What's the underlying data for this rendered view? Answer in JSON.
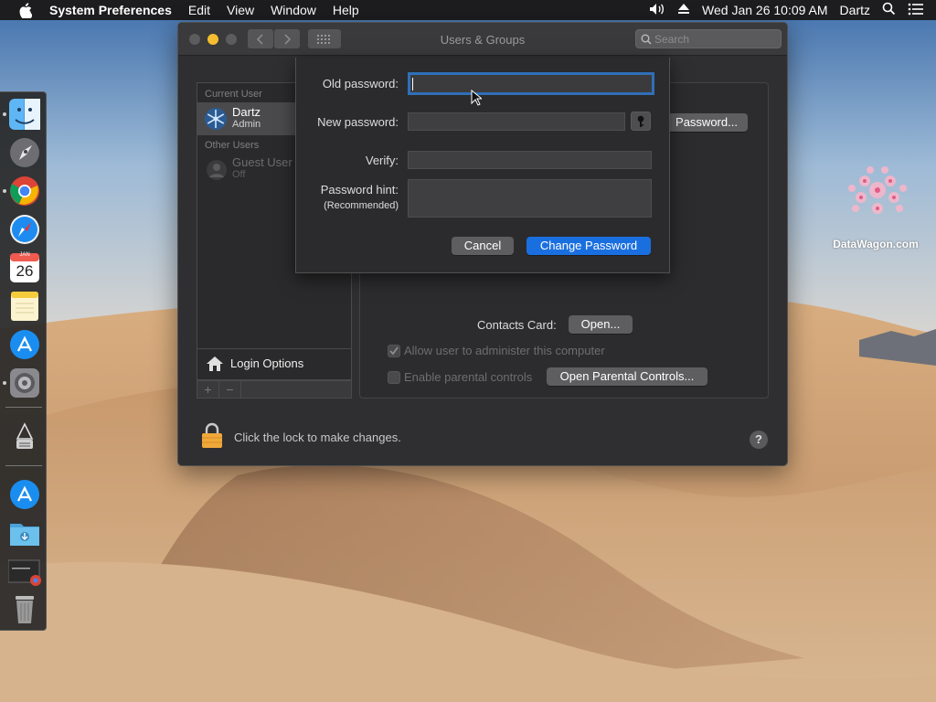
{
  "menubar": {
    "app_name": "System Preferences",
    "items": [
      "Edit",
      "View",
      "Window",
      "Help"
    ],
    "datetime": "Wed Jan 26  10:09 AM",
    "user": "Dartz"
  },
  "dock": {
    "calendar": {
      "month": "JAN",
      "day": "26"
    }
  },
  "watermark": "DataWagon.com",
  "window": {
    "title": "Users & Groups",
    "search_placeholder": "Search",
    "sidebar": {
      "current_header": "Current User",
      "current_user": {
        "name": "Dartz",
        "role": "Admin"
      },
      "other_header": "Other Users",
      "guest_user": {
        "name": "Guest User",
        "status": "Off"
      },
      "login_options": "Login Options",
      "add": "+",
      "remove": "−"
    },
    "panel": {
      "password_button": "Password...",
      "contacts_label": "Contacts Card:",
      "open_button": "Open...",
      "allow_admin": "Allow user to administer this computer",
      "allow_admin_checked": true,
      "parental": "Enable parental controls",
      "parental_checked": false,
      "open_parental_button": "Open Parental Controls..."
    },
    "lock_text": "Click the lock to make changes.",
    "help": "?"
  },
  "sheet": {
    "old_password_label": "Old password:",
    "old_password_value": "",
    "new_password_label": "New password:",
    "new_password_value": "",
    "verify_label": "Verify:",
    "verify_value": "",
    "hint_label": "Password hint:",
    "hint_sublabel": "(Recommended)",
    "hint_value": "",
    "cancel": "Cancel",
    "change": "Change Password"
  },
  "colors": {
    "accent": "#1a6fe0",
    "focus_ring": "#2f6fb8",
    "window_bg": "#2f2f31",
    "menubar_bg": "#1d1d1f"
  }
}
